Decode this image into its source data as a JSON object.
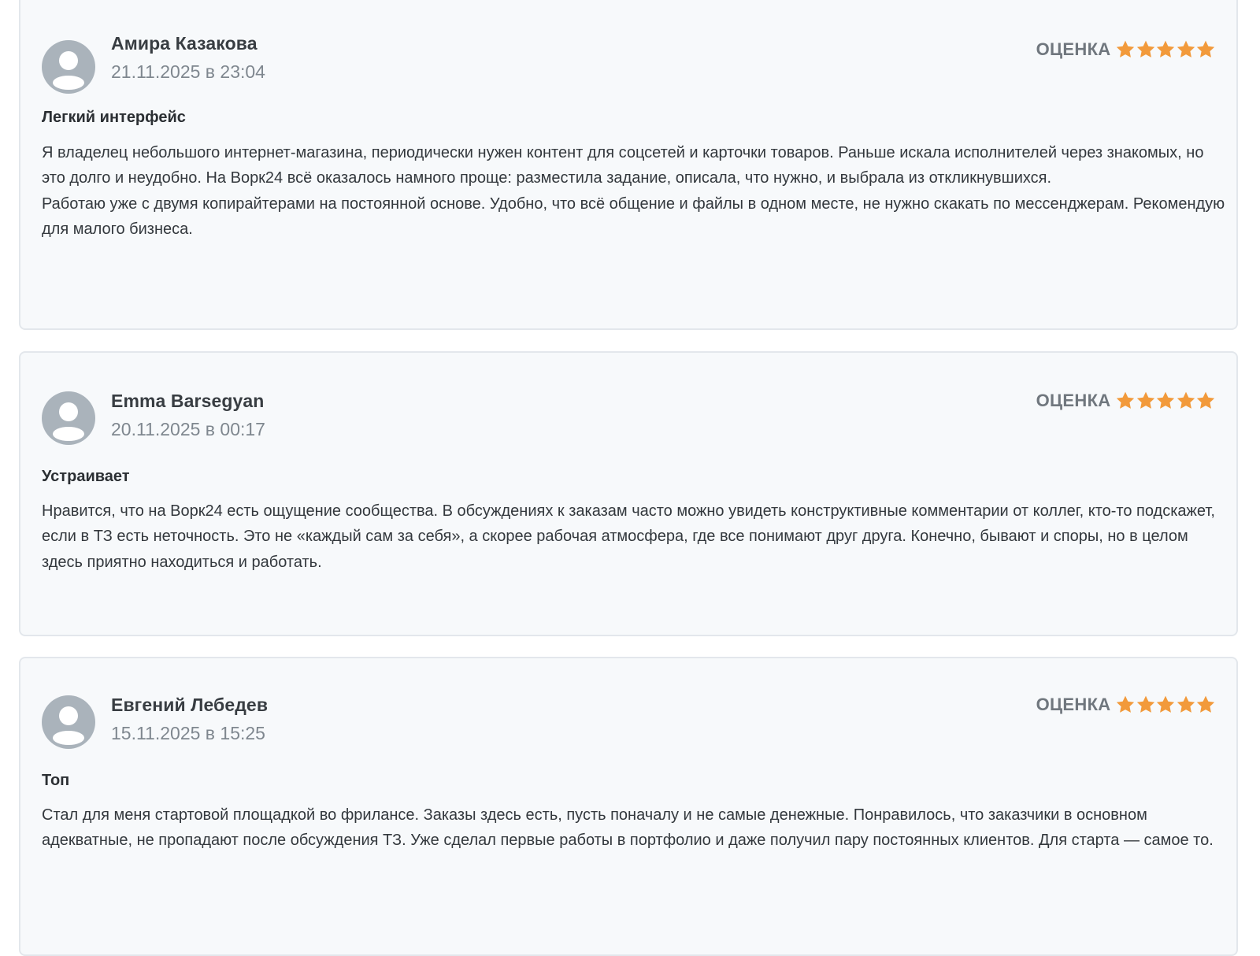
{
  "accent": {
    "star_color": "#f29a3b",
    "avatar_color": "#aab3bb"
  },
  "reviews": [
    {
      "author": "Амира Казакова",
      "date": "21.11.2025 в 23:04",
      "rating_label": "ОЦЕНКА",
      "rating": 5,
      "title": "Легкий интерфейс",
      "text": "Я владелец небольшого интернет-магазина, периодически нужен контент для соцсетей и карточки товаров. Раньше искала исполнителей через знакомых, но это долго и неудобно. На Ворк24 всё оказалось намного проще: разместила задание, описала, что нужно, и выбрала из откликнувшихся.\nРаботаю уже с двумя копирайтерами на постоянной основе. Удобно, что всё общение и файлы в одном месте, не нужно скакать по мессенджерам. Рекомендую для малого бизнеса."
    },
    {
      "author": "Emma Barsegyan",
      "date": "20.11.2025 в 00:17",
      "rating_label": "ОЦЕНКА",
      "rating": 5,
      "title": "Устраивает",
      "text": "Нравится, что на Ворк24 есть ощущение сообщества. В обсуждениях к заказам часто можно увидеть конструктивные комментарии от коллег, кто-то подскажет, если в ТЗ есть неточность. Это не «каждый сам за себя», а скорее рабочая атмосфера, где все понимают друг друга. Конечно, бывают и споры, но в целом здесь приятно находиться и работать."
    },
    {
      "author": "Евгений Лебедев",
      "date": "15.11.2025 в 15:25",
      "rating_label": "ОЦЕНКА",
      "rating": 5,
      "title": "Топ",
      "text": "Стал для меня стартовой площадкой во фрилансе. Заказы здесь есть, пусть поначалу и не самые денежные. Понравилось, что заказчики в основном адекватные, не пропадают после обсуждения ТЗ. Уже сделал первые работы в портфолио и даже получил пару постоянных клиентов. Для старта — самое то."
    }
  ]
}
